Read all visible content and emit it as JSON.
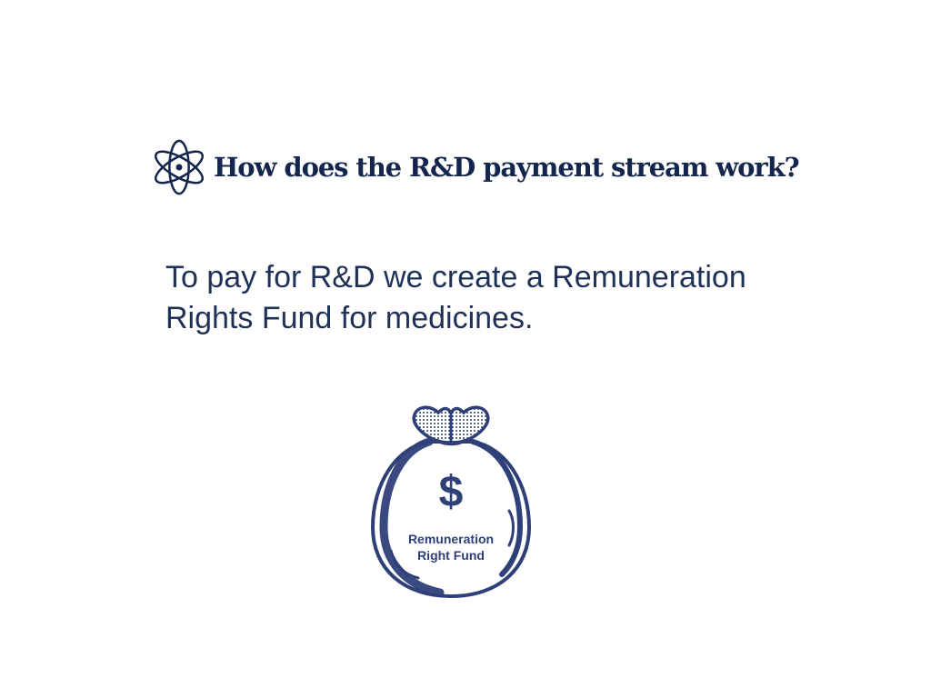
{
  "slide": {
    "title": "How does the R&D payment stream work?",
    "body_lines": [
      "To pay for R&D we create a Remuneration",
      "Rights Fund for medicines."
    ],
    "icons": {
      "heading": "atom-icon",
      "illustration": "money-bag-icon"
    },
    "money_bag": {
      "currency_symbol": "$",
      "label_lines": [
        "Remuneration",
        "Right Fund"
      ]
    }
  },
  "colors": {
    "title": "#14264d",
    "body_text": "#1f3156",
    "bag_outline": "#2f3f78",
    "background": "#ffffff"
  }
}
